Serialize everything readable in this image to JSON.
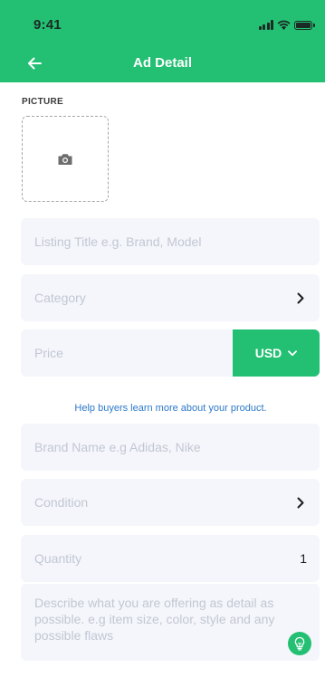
{
  "status_bar": {
    "time": "9:41"
  },
  "header": {
    "title": "Ad Detail",
    "back_icon": "arrow-left-icon"
  },
  "picture": {
    "label": "PICTURE",
    "icon": "camera-icon"
  },
  "form": {
    "listing_title": {
      "placeholder": "Listing Title e.g. Brand, Model"
    },
    "category": {
      "placeholder": "Category",
      "icon": "chevron-right-icon"
    },
    "price": {
      "placeholder": "Price",
      "currency": "USD",
      "currency_icon": "chevron-down-icon"
    },
    "helper_text": "Help buyers learn more about your product.",
    "brand": {
      "placeholder": "Brand Name e.g Adidas, Nike"
    },
    "condition": {
      "placeholder": "Condition",
      "icon": "chevron-right-icon"
    },
    "quantity": {
      "placeholder": "Quantity",
      "value": "1"
    },
    "description": {
      "placeholder": "Describe what you are offering as detail as possible. e.g item size, color, style and any possible flaws",
      "tip_icon": "lightbulb-icon"
    }
  },
  "colors": {
    "accent": "#23c073",
    "field_bg": "#f4f6fb",
    "placeholder": "#c3c7d3",
    "link": "#2c79c9"
  }
}
